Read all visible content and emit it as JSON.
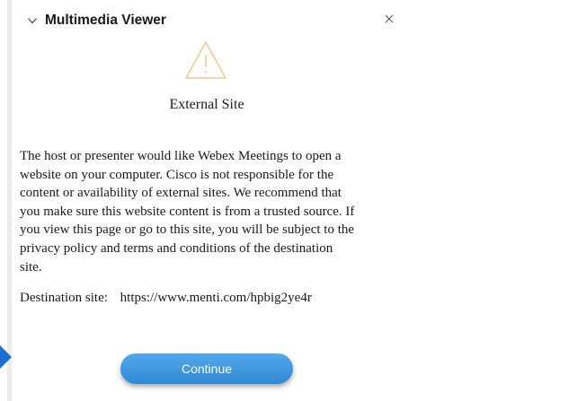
{
  "panel": {
    "title": "Multimedia Viewer",
    "collapse_icon": "chevron-down-icon",
    "close_icon": "close-icon"
  },
  "dialog": {
    "warning_icon": "warning-triangle-icon",
    "heading": "External Site",
    "body_lines": [
      "The host or presenter would like Webex Meetings to open a",
      "website on your computer. Cisco is not responsible for the",
      "content or availability of external sites. We recommend that",
      "you make sure this website content is from a trusted source. If",
      "you view this page or go to this site, you will be subject to the",
      "privacy policy and terms and conditions of the destination",
      "site."
    ],
    "destination_label": "Destination site:",
    "destination_url": "https://www.menti.com/hpbig2ye4r",
    "continue_label": "Continue"
  },
  "colors": {
    "button": "#3f9ae2",
    "warning": "#f3c58a",
    "pointer": "#1b6fd1"
  }
}
